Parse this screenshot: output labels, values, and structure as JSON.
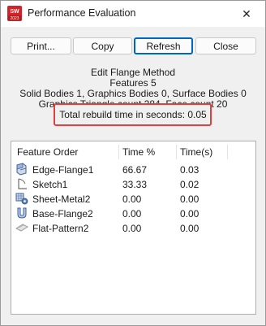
{
  "window": {
    "title": "Performance Evaluation",
    "app_icon_badge": "2023",
    "close_glyph": "✕"
  },
  "buttons": {
    "print": "Print...",
    "copy": "Copy",
    "refresh": "Refresh",
    "close": "Close"
  },
  "info": {
    "method": "Edit Flange Method",
    "features": "Features 5",
    "bodies": "Solid Bodies 1, Graphics Bodies 0, Surface Bodies 0",
    "graphics": "Graphics Triangle count 284, Face count 20",
    "rebuild_time": "Total rebuild time in seconds: 0.05"
  },
  "table": {
    "headers": {
      "feature": "Feature Order",
      "time_pct": "Time %",
      "time_s": "Time(s)"
    },
    "rows": [
      {
        "icon": "edge-flange-icon",
        "feature": "Edge-Flange1",
        "time_pct": "66.67",
        "time_s": "0.03"
      },
      {
        "icon": "sketch-icon",
        "feature": "Sketch1",
        "time_pct": "33.33",
        "time_s": "0.02"
      },
      {
        "icon": "sheet-metal-icon",
        "feature": "Sheet-Metal2",
        "time_pct": "0.00",
        "time_s": "0.00"
      },
      {
        "icon": "base-flange-icon",
        "feature": "Base-Flange2",
        "time_pct": "0.00",
        "time_s": "0.00"
      },
      {
        "icon": "flat-pattern-icon",
        "feature": "Flat-Pattern2",
        "time_pct": "0.00",
        "time_s": "0.00"
      }
    ]
  },
  "colors": {
    "highlight": "#e0403f",
    "default_button_border": "#0067c0"
  }
}
